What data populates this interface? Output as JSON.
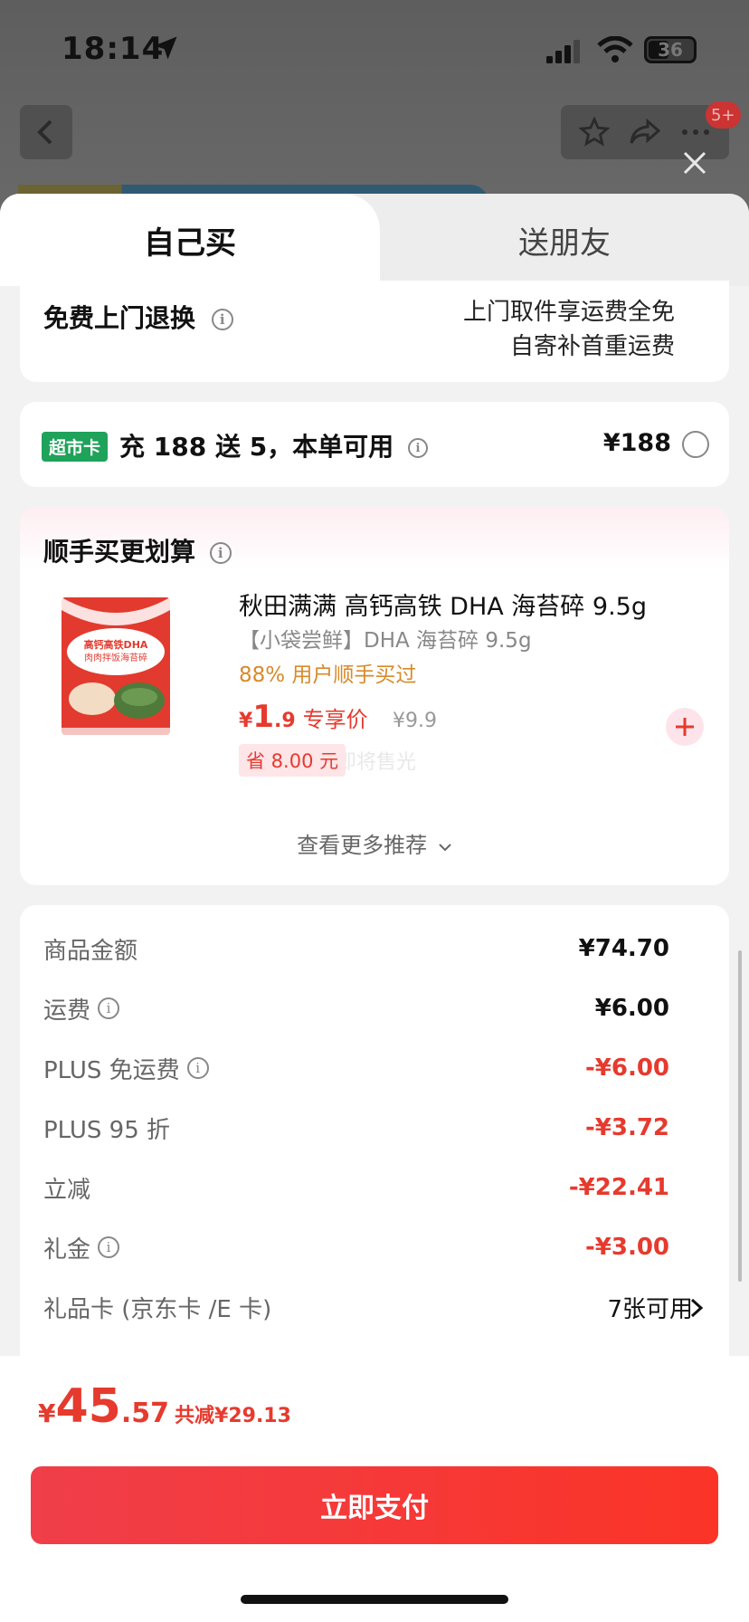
{
  "status": {
    "time": "18:14",
    "battery": "36"
  },
  "nav": {
    "badge": "5+"
  },
  "tabs": {
    "self": "自己买",
    "gift": "送朋友"
  },
  "returns": {
    "title": "免费上门退换",
    "line1": "上门取件享运费全免",
    "line2": "自寄补首重运费"
  },
  "supermarket": {
    "tag": "超市卡",
    "text": "充 188 送 5，本单可用",
    "price": "¥188"
  },
  "recommend": {
    "title": "顺手买更划算",
    "product": {
      "name": "秋田满满 高钙高铁 DHA 海苔碎 9.5g",
      "sub": "【小袋尝鲜】DHA 海苔碎 9.5g",
      "stat": "88% 用户顺手买过",
      "price_yen": "¥",
      "price_int": "1",
      "price_dec": ".9",
      "price_label": "专享价",
      "orig_price": "¥9.9",
      "save": "省 8.00 元",
      "ghost": "即将售光",
      "package_text": "高钙高铁DHA 肉肉拌饭海苔碎"
    },
    "more": "查看更多推荐"
  },
  "summary": {
    "rows": [
      {
        "label": "商品金额",
        "value": "¥74.70"
      },
      {
        "label": "运费",
        "value": "¥6.00"
      },
      {
        "label": "PLUS 免运费",
        "value": "-¥6.00"
      },
      {
        "label": "PLUS 95 折",
        "value": "-¥3.72"
      },
      {
        "label": "立减",
        "value": "-¥22.41"
      },
      {
        "label": "礼金",
        "value": "-¥3.00"
      },
      {
        "label": "礼品卡 (京东卡 /E 卡)",
        "value": "7张可用"
      }
    ]
  },
  "footer": {
    "total_yen": "¥",
    "total_int": "45",
    "total_dec": ".57",
    "saved": "共减¥29.13",
    "pay": "立即支付"
  },
  "colors": {
    "accent": "#e63a2e",
    "super_tag": "#1fa25a",
    "stat": "#d88a2a"
  }
}
